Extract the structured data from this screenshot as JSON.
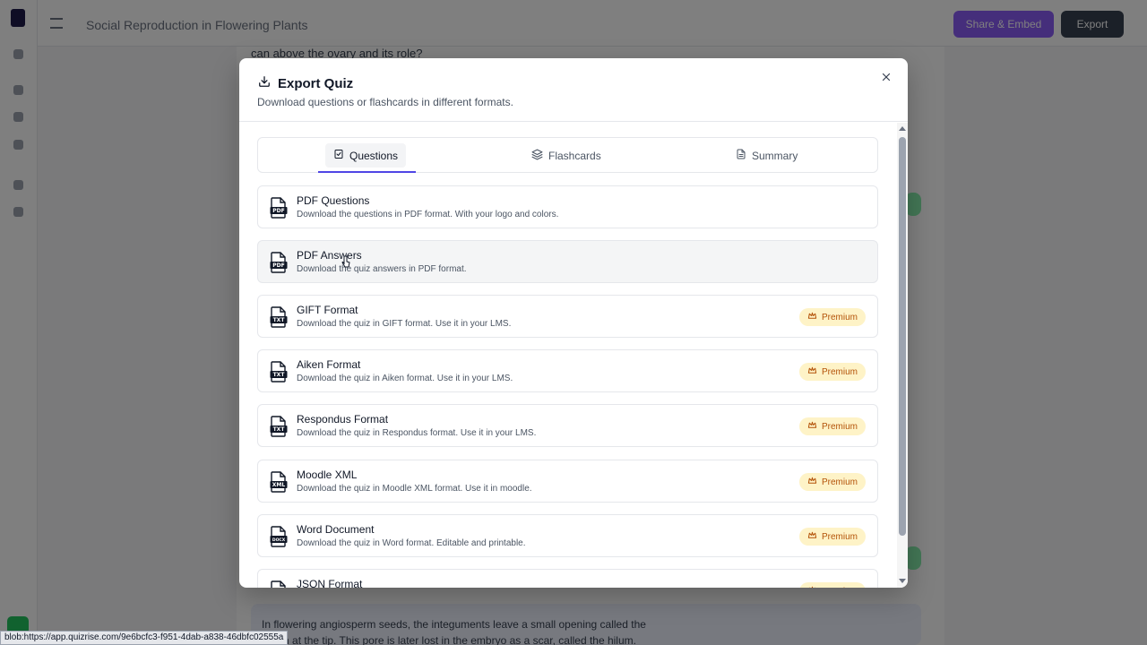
{
  "background": {
    "page_title": "Social Reproduction in Flowering Plants",
    "line_top": "can above the ovary and its role?",
    "line_bottom1": "In flowering angiosperm seeds, the integuments leave a small opening called the",
    "line_bottom2": "which at the tip. This pore is later lost in the embryo as a scar, called the hilum.",
    "btn_share": "Share & Embed",
    "btn_export": "Export"
  },
  "modal": {
    "title": "Export Quiz",
    "subtitle": "Download questions or flashcards in different formats."
  },
  "tabs": [
    {
      "label": "Questions"
    },
    {
      "label": "Flashcards"
    },
    {
      "label": "Summary"
    }
  ],
  "items": [
    {
      "name": "PDF Questions",
      "desc": "Download the questions in PDF format. With your logo and colors.",
      "icon": "pdf-file-icon",
      "badge": ""
    },
    {
      "name": "PDF Answers",
      "desc": "Download the quiz answers in PDF format.",
      "icon": "pdf-file-icon",
      "badge": ""
    },
    {
      "name": "GIFT Format",
      "desc": "Download the quiz in GIFT format. Use it in your LMS.",
      "icon": "txt-file-icon",
      "badge": "Premium"
    },
    {
      "name": "Aiken Format",
      "desc": "Download the quiz in Aiken format. Use it in your LMS.",
      "icon": "txt-file-icon",
      "badge": "Premium"
    },
    {
      "name": "Respondus Format",
      "desc": "Download the quiz in Respondus format. Use it in your LMS.",
      "icon": "txt-file-icon",
      "badge": "Premium"
    },
    {
      "name": "Moodle XML",
      "desc": "Download the quiz in Moodle XML format. Use it in moodle.",
      "icon": "xml-file-icon",
      "badge": "Premium"
    },
    {
      "name": "Word Document",
      "desc": "Download the quiz in Word format. Editable and printable.",
      "icon": "docx-file-icon",
      "badge": "Premium"
    },
    {
      "name": "JSON Format",
      "desc": "",
      "icon": "json-file-icon",
      "badge": "Premium"
    }
  ],
  "statusbar": {
    "url": "blob:https://app.quizrise.com/9e6bcfc3-f951-4dab-a838-46dbfc02555a"
  },
  "colors": {
    "accent": "#4f46e5",
    "premium_bg": "#fef3c7",
    "premium_text": "#b45309"
  }
}
